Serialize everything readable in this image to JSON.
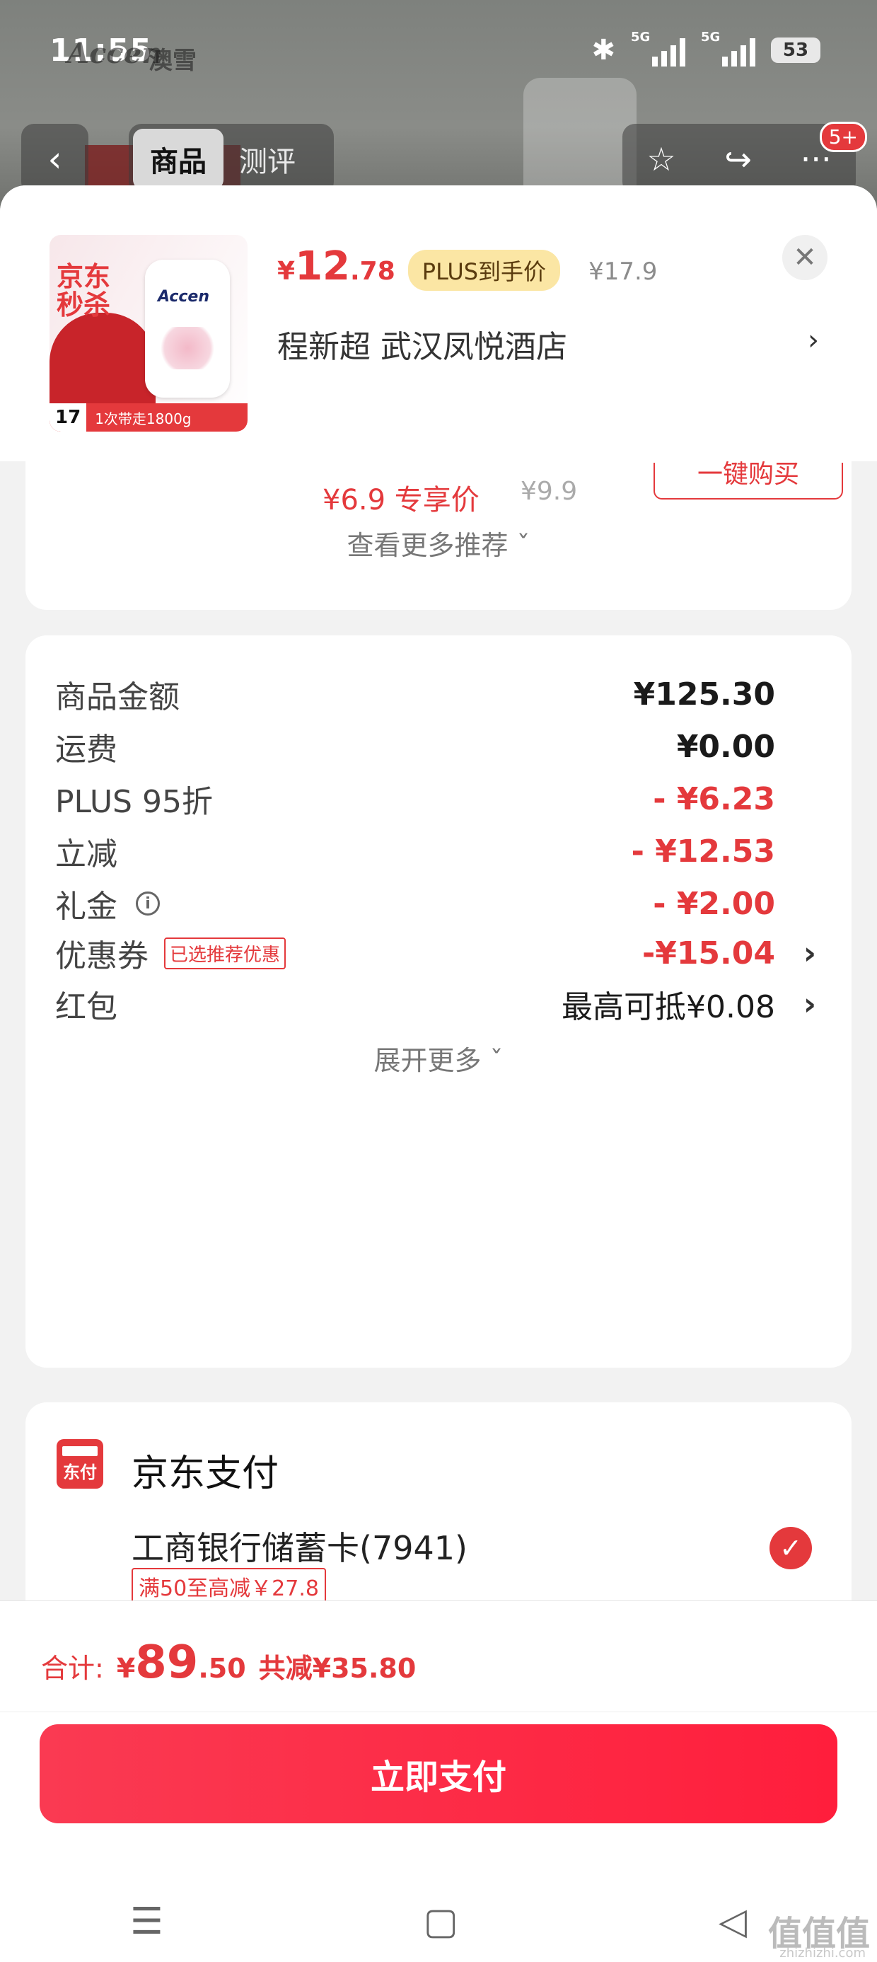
{
  "status_bar": {
    "time": "11:55",
    "brand_logo": "Accen",
    "brand_cn": "澳雪",
    "network1": "5G",
    "network2": "5G",
    "battery": "53"
  },
  "top_nav": {
    "back": "‹",
    "tab_goods": "商品",
    "tab_review": "测评",
    "star": "☆",
    "share": "↪",
    "more": "···",
    "badge": "5+"
  },
  "product": {
    "price_symbol": "¥",
    "price_int": "12",
    "price_dec": ".78",
    "plus_tag": "PLUS到手价",
    "original_price": "¥17.9",
    "address": "程新超  武汉凤悦酒店",
    "close": "✕",
    "thumb_seckill": "京东秒杀",
    "thumb_brand": "Accen",
    "thumb_num": "17",
    "thumb_strip": "1次带走1800g"
  },
  "recommend": {
    "cut_price": "¥6.9 专享价",
    "cut_orig": "¥9.9",
    "cut_btn": "一键购买",
    "more": "查看更多推荐 ˇ"
  },
  "fees": {
    "goods_label": "商品金额",
    "goods_value": "¥125.30",
    "ship_label": "运费",
    "ship_value": "¥0.00",
    "plus_label": "PLUS 95折",
    "plus_value": "- ¥6.23",
    "instant_label": "立减",
    "instant_value": "- ¥12.53",
    "gift_label": "礼金",
    "gift_value": "- ¥2.00",
    "coupon_label": "优惠券",
    "coupon_tag": "已选推荐优惠",
    "coupon_value": "-¥15.04",
    "redpack_label": "红包",
    "redpack_value": "最高可抵¥0.08",
    "expand": "展开更多 ˇ"
  },
  "payment": {
    "icon_text": "东付",
    "title": "京东支付",
    "bank": "工商银行储蓄卡(7941)",
    "promo": "满50至高减￥27.8"
  },
  "footer": {
    "total_label": "合计:",
    "total_symbol": "¥",
    "total_int": "89",
    "total_dec": ".50",
    "total_saved": "共减¥35.80",
    "pay_button": "立即支付"
  },
  "watermark": "值值值",
  "watermark_sub": "zhizhizhi.com",
  "colors": {
    "accent_red": "#e4393c",
    "plus_gold": "#fbe6a4",
    "pay_button": "#ff1e3c"
  }
}
